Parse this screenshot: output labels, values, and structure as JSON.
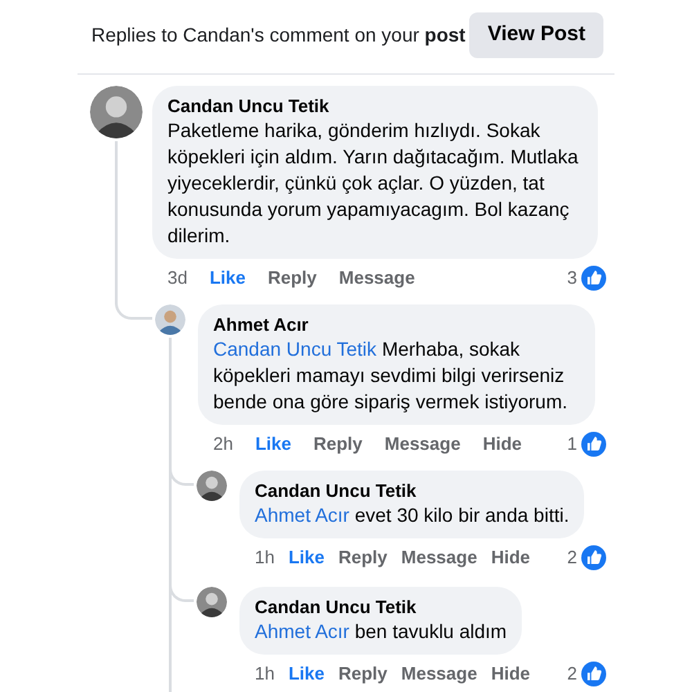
{
  "header": {
    "title": "Replies to Candan's comment on your **post**",
    "button": "View Post"
  },
  "comments": [
    {
      "author": "Candan Uncu Tetik",
      "text": "Paketleme harika, gönderim hızlıydı. Sokak köpekleri için aldım. Yarın dağıtacağım. Mutlaka yiyeceklerdir, çünkü çok açlar. O yüzden, tat konusunda yorum yapamıyacagım. Bol kazanç dilerim.",
      "time": "3d",
      "actions": [
        {
          "label": "Like",
          "kind": "like"
        },
        {
          "label": "Reply",
          "kind": "plain"
        },
        {
          "label": "Message",
          "kind": "plain"
        }
      ],
      "like_count": "3",
      "children": [
        {
          "author": "Ahmet Acır",
          "mention": "Candan Uncu Tetik",
          "text": "Merhaba,  sokak köpekleri mamayı sevdimi bilgi verirseniz bende ona göre sipariş vermek istiyorum.",
          "time": "2h",
          "actions": [
            {
              "label": "Like",
              "kind": "like"
            },
            {
              "label": "Reply",
              "kind": "plain"
            },
            {
              "label": "Message",
              "kind": "plain"
            },
            {
              "label": "Hide",
              "kind": "plain"
            }
          ],
          "like_count": "1",
          "children": [
            {
              "author": "Candan Uncu Tetik",
              "mention": "Ahmet Acır",
              "text": "evet 30 kilo bir anda bitti.",
              "time": "1h",
              "actions": [
                {
                  "label": "Like",
                  "kind": "like"
                },
                {
                  "label": "Reply",
                  "kind": "plain"
                },
                {
                  "label": "Message",
                  "kind": "plain"
                },
                {
                  "label": "Hide",
                  "kind": "plain"
                }
              ],
              "like_count": "2"
            },
            {
              "author": "Candan Uncu Tetik",
              "mention": "Ahmet Acır",
              "text": "ben tavuklu aldım",
              "time": "1h",
              "actions": [
                {
                  "label": "Like",
                  "kind": "like"
                },
                {
                  "label": "Reply",
                  "kind": "plain"
                },
                {
                  "label": "Message",
                  "kind": "plain"
                },
                {
                  "label": "Hide",
                  "kind": "plain"
                }
              ],
              "like_count": "2"
            }
          ]
        }
      ]
    }
  ]
}
